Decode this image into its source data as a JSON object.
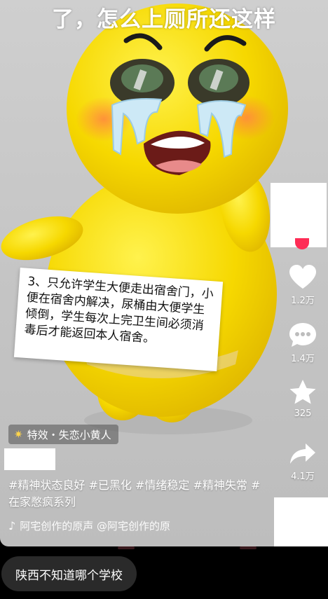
{
  "video": {
    "subtitle": "了，怎么上厕所还这样",
    "card_text": "3、只允许学生大便走出宿舍门，小便在宿舍内解决，尿桶由大便学生倾倒，学生每次上完卫生间必须消毒后才能返回本人宿舍。"
  },
  "effect": {
    "label": "特效・失恋小黄人",
    "icon": "sparkle-icon"
  },
  "caption": {
    "hashtags": "#精神状态良好 #已黑化 #情绪稳定 #精神失常 #在家憋疯系列"
  },
  "music": {
    "icon": "music-note-icon",
    "text": "阿宅创作的原声    @阿宅创作的原"
  },
  "actions": {
    "like_count": "1.2万",
    "comment_count": "1.4万",
    "favorite_count": "325",
    "share_count": "4.1万"
  },
  "comment_bar": {
    "text": "陕西不知道哪个学校"
  },
  "colors": {
    "accent": "#fe2c55",
    "character_yellow": "#f6d800"
  }
}
